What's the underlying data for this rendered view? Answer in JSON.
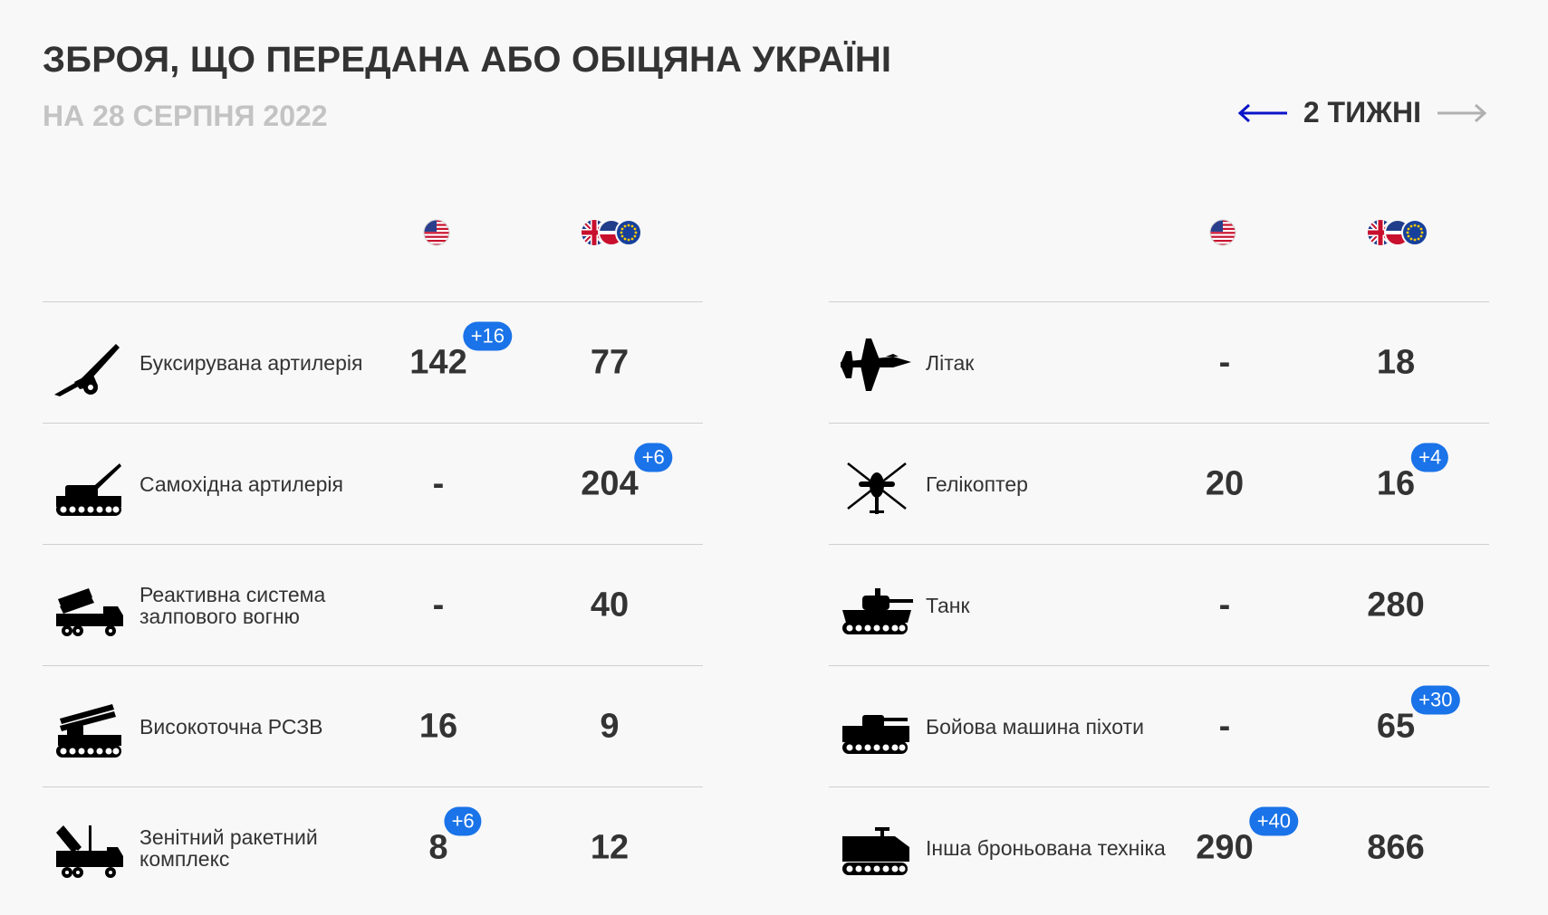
{
  "title": "ЗБРОЯ, ЩО ПЕРЕДАНА АБО ОБІЦЯНА УКРАЇНІ",
  "subtitle": "НА 28 СЕРПНЯ 2022",
  "nav": {
    "label": "2 ТИЖНІ",
    "prev_color": "#0a14c8",
    "next_color": "#b0b0b0"
  },
  "colors": {
    "badge": "#1a73e8",
    "text": "#333333",
    "divider": "#cfcfcf"
  },
  "columns": [
    {
      "id": "us",
      "icon": "us-flag-icon"
    },
    {
      "id": "other",
      "icon": "uk-eu-flags-icon"
    }
  ],
  "chart_data": {
    "type": "table",
    "left": [
      {
        "label": "Буксирувана артилерія",
        "icon": "towed-artillery-icon",
        "us": "142",
        "us_change": "+16",
        "other": "77",
        "other_change": ""
      },
      {
        "label": "Самохідна артилерія",
        "icon": "self-propelled-artillery-icon",
        "us": "-",
        "us_change": "",
        "other": "204",
        "other_change": "+6"
      },
      {
        "label": "Реактивна система залпового вогню",
        "icon": "mlrs-truck-icon",
        "us": "-",
        "us_change": "",
        "other": "40",
        "other_change": ""
      },
      {
        "label": "Високоточна РСЗВ",
        "icon": "precision-mlrs-icon",
        "us": "16",
        "us_change": "",
        "other": "9",
        "other_change": ""
      },
      {
        "label": "Зенітний ракетний комплекс",
        "icon": "air-defense-icon",
        "us": "8",
        "us_change": "+6",
        "other": "12",
        "other_change": ""
      }
    ],
    "right": [
      {
        "label": "Літак",
        "icon": "fighter-jet-icon",
        "us": "-",
        "us_change": "",
        "other": "18",
        "other_change": ""
      },
      {
        "label": "Гелікоптер",
        "icon": "helicopter-icon",
        "us": "20",
        "us_change": "",
        "other": "16",
        "other_change": "+4"
      },
      {
        "label": "Танк",
        "icon": "tank-icon",
        "us": "-",
        "us_change": "",
        "other": "280",
        "other_change": ""
      },
      {
        "label": "Бойова машина піхоти",
        "icon": "ifv-icon",
        "us": "-",
        "us_change": "",
        "other": "65",
        "other_change": "+30"
      },
      {
        "label": "Інша броньована техніка",
        "icon": "armored-vehicle-icon",
        "us": "290",
        "us_change": "+40",
        "other": "866",
        "other_change": ""
      }
    ]
  }
}
